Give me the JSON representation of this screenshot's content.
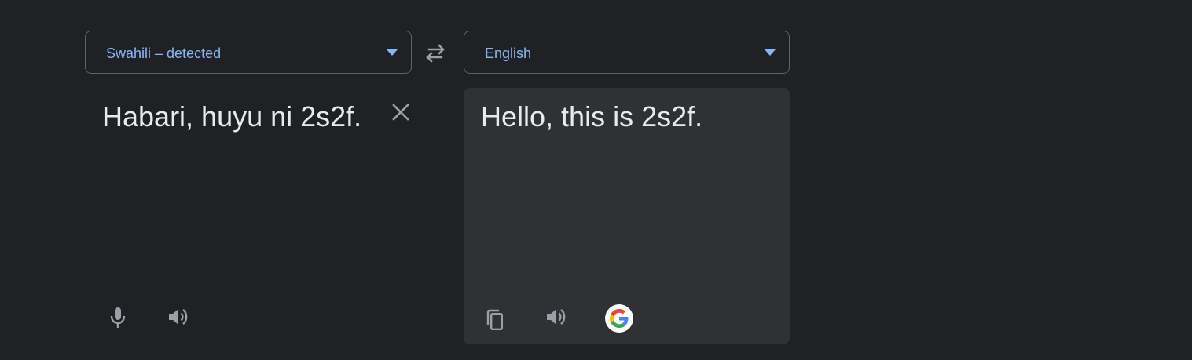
{
  "source_language": {
    "label": "Swahili – detected"
  },
  "target_language": {
    "label": "English"
  },
  "source": {
    "text": "Habari, huyu ni 2s2f."
  },
  "target": {
    "text": "Hello, this is 2s2f."
  },
  "icons": {
    "swap": "swap-arrows-icon",
    "clear": "close-icon",
    "mic": "microphone-icon",
    "listen_source": "speaker-icon",
    "copy": "copy-icon",
    "listen_target": "speaker-icon",
    "google": "google-g-icon"
  },
  "colors": {
    "background": "#202124",
    "panel": "#303134",
    "accent": "#8ab4f8",
    "text": "#e8eaed",
    "icon": "#9aa0a6"
  }
}
